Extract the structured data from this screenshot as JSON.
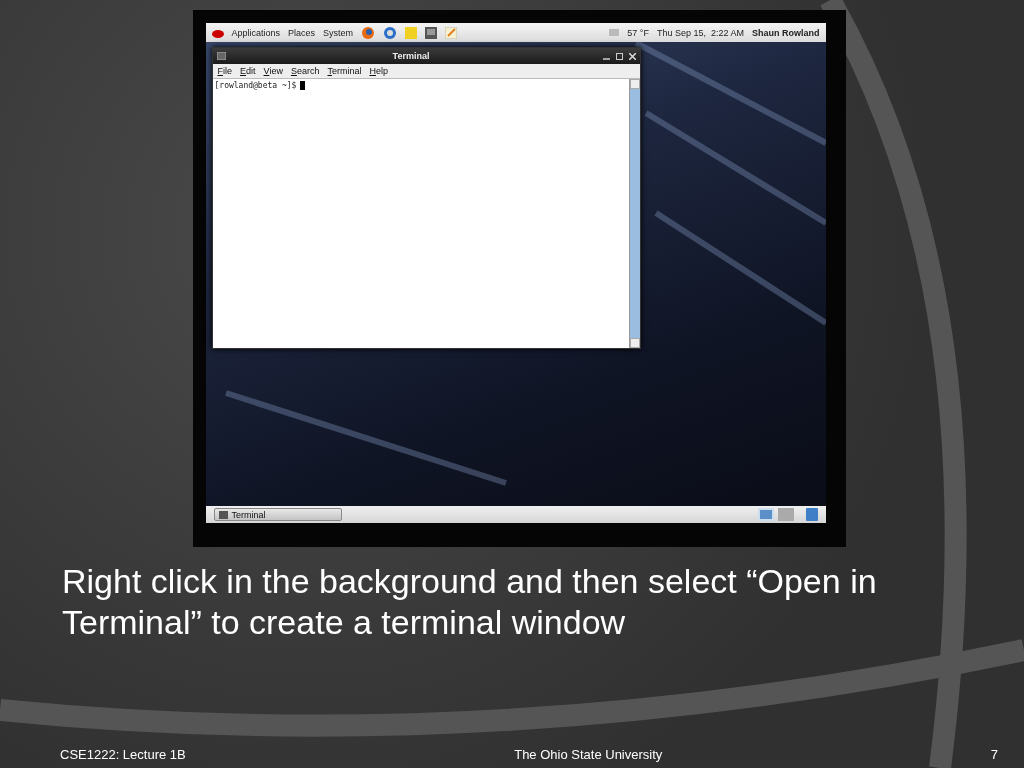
{
  "slide": {
    "screenshot": {
      "top_panel": {
        "menus": [
          "Applications",
          "Places",
          "System"
        ],
        "weather": "57 °F",
        "clock": "Thu Sep 15,  2:22 AM",
        "user": "Shaun Rowland"
      },
      "terminal": {
        "title": "Terminal",
        "menu": [
          "File",
          "Edit",
          "View",
          "Search",
          "Terminal",
          "Help"
        ],
        "prompt": "[rowland@beta ~]$"
      },
      "taskbar": {
        "tasks": [
          "Terminal"
        ],
        "workspaces": [
          {
            "selected": true
          },
          {
            "selected": false
          }
        ]
      }
    },
    "caption": "Right click in the background and then select “Open in Terminal” to create a terminal window",
    "footer": {
      "course": "CSE1222: Lecture 1B",
      "university": "The Ohio State University",
      "page": "7"
    }
  }
}
